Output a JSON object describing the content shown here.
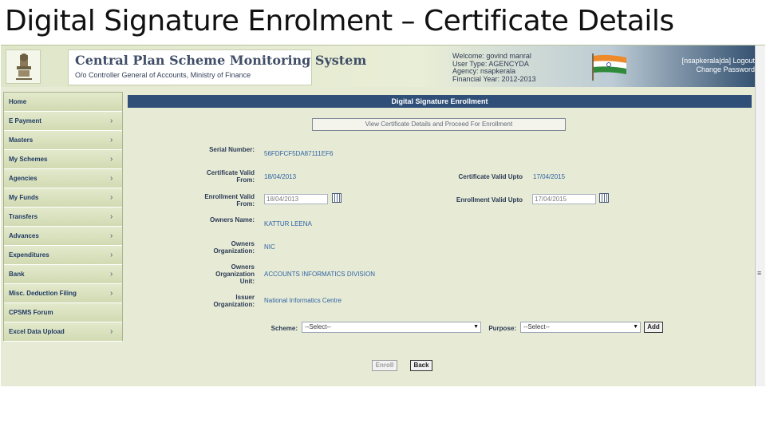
{
  "slide": {
    "title": "Digital Signature Enrolment – Certificate Details"
  },
  "header": {
    "app_title": "Central Plan Scheme Monitoring System",
    "app_subtitle": "O/o Controller General of Accounts, Ministry of Finance",
    "user_lines": [
      "Welcome: govind manral",
      "User Type: AGENCYDA",
      "Agency: nsapkerala",
      "Financial Year: 2012-2013"
    ],
    "top_links": [
      "[nsapkerala|da]   Logout",
      "Change Password"
    ]
  },
  "sidebar": {
    "items": [
      {
        "label": "Home",
        "has_chevron": false
      },
      {
        "label": "E Payment",
        "has_chevron": true
      },
      {
        "label": "Masters",
        "has_chevron": true
      },
      {
        "label": "My Schemes",
        "has_chevron": true
      },
      {
        "label": "Agencies",
        "has_chevron": true
      },
      {
        "label": "My Funds",
        "has_chevron": true
      },
      {
        "label": "Transfers",
        "has_chevron": true
      },
      {
        "label": "Advances",
        "has_chevron": true
      },
      {
        "label": "Expenditures",
        "has_chevron": true
      },
      {
        "label": "Bank",
        "has_chevron": true
      },
      {
        "label": "Misc. Deduction Filing",
        "has_chevron": true
      },
      {
        "label": "CPSMS Forum",
        "has_chevron": false
      },
      {
        "label": "Excel Data Upload",
        "has_chevron": true
      }
    ]
  },
  "main": {
    "bar_title": "Digital Signature Enrollment",
    "view_button": "View Certificate Details and Proceed For Enrollment",
    "fields": {
      "serial_label": "Serial Number:",
      "serial_value": "56FDFCF5DA87111EF6",
      "cert_from_label": "Certificate Valid From:",
      "cert_from_value": "18/04/2013",
      "cert_upto_label": "Certificate Valid Upto",
      "cert_upto_value": "17/04/2015",
      "enroll_from_label": "Enrollment Valid From:",
      "enroll_from_value": "18/04/2013",
      "enroll_upto_label": "Enrollment Valid Upto",
      "enroll_upto_value": "17/04/2015",
      "owner_name_label": "Owners Name:",
      "owner_name_value": "KATTUR LEENA",
      "owner_org_label": "Owners Organization:",
      "owner_org_value": "NIC",
      "owner_unit_label": "Owners Organization Unit:",
      "owner_unit_value": "ACCOUNTS INFORMATICS DIVISION",
      "issuer_label": "Issuer Organization:",
      "issuer_value": "National Informatics Centre"
    },
    "scheme_label": "Scheme:",
    "scheme_value": "--Select--",
    "purpose_label": "Purpose:",
    "purpose_value": "--Select--",
    "add_button": "Add",
    "enroll_button": "Enroll",
    "back_button": "Back"
  },
  "colors": {
    "bar": "#2f4f79",
    "value_text": "#2f63a6",
    "page_bg": "#e7ebd5"
  },
  "icons": {
    "calendar": "calendar-icon",
    "chevron": "chevron-right-icon",
    "flag": "indian-flag-icon",
    "emblem": "national-emblem-icon"
  }
}
